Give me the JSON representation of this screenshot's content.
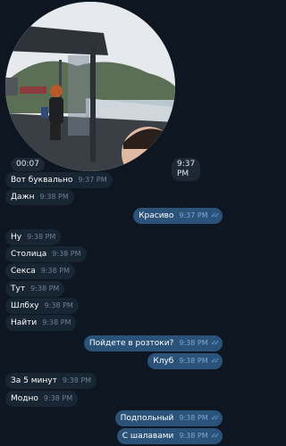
{
  "video_note": {
    "duration": "00:07",
    "time": "9:37 PM"
  },
  "messages": [
    {
      "dir": "in",
      "text": "Вот буквально",
      "time": "9:37 PM"
    },
    {
      "dir": "in",
      "text": "Дажн",
      "time": "9:38 PM"
    },
    {
      "dir": "out",
      "text": "Красиво",
      "time": "9:37 PM"
    },
    {
      "dir": "in",
      "text": "Ну",
      "time": "9:38 PM"
    },
    {
      "dir": "in",
      "text": "Столица",
      "time": "9:38 PM"
    },
    {
      "dir": "in",
      "text": "Секса",
      "time": "9:38 PM"
    },
    {
      "dir": "in",
      "text": "Тут",
      "time": "9:38 PM"
    },
    {
      "dir": "in",
      "text": "Шлбху",
      "time": "9:38 PM"
    },
    {
      "dir": "in",
      "text": "Найти",
      "time": "9:38 PM"
    },
    {
      "dir": "out",
      "text": "Пойдете в розтоки?",
      "time": "9:38 PM"
    },
    {
      "dir": "out",
      "text": "Клуб",
      "time": "9:38 PM"
    },
    {
      "dir": "in",
      "text": "За 5 минут",
      "time": "9:38 PM"
    },
    {
      "dir": "in",
      "text": "Модно",
      "time": "9:38 PM"
    },
    {
      "dir": "out",
      "text": "Подпольный",
      "time": "9:38 PM"
    },
    {
      "dir": "out",
      "text": "С шалавами",
      "time": "9:38 PM"
    }
  ],
  "colors": {
    "background": "#0e1621",
    "incoming": "#182533",
    "outgoing": "#2b5278",
    "read_ticks": "#5fb3f5"
  },
  "icons": [
    "double-check-icon"
  ]
}
